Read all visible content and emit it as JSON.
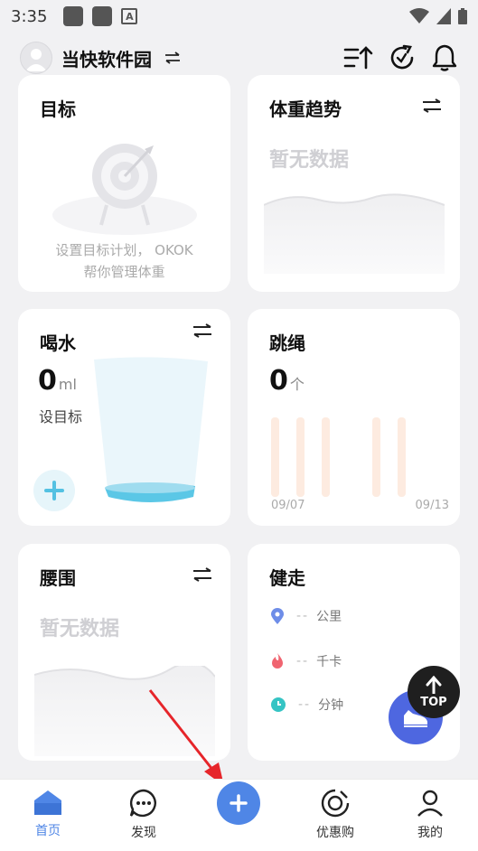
{
  "status": {
    "time": "3:35"
  },
  "header": {
    "user_name": "当快软件园"
  },
  "goal": {
    "title": "目标",
    "desc_line1": "设置目标计划， OKOK",
    "desc_line2": "帮你管理体重"
  },
  "weight": {
    "title": "体重趋势",
    "empty": "暂无数据"
  },
  "water": {
    "title": "喝水",
    "value": "0",
    "unit": "ml",
    "set_goal": "设目标"
  },
  "rope": {
    "title": "跳绳",
    "value": "0",
    "unit": "个",
    "date_start": "09/07",
    "date_end": "09/13"
  },
  "waist": {
    "title": "腰围",
    "empty": "暂无数据"
  },
  "walk": {
    "title": "健走",
    "stats": [
      {
        "value": "--",
        "unit": "公里"
      },
      {
        "value": "--",
        "unit": "千卡"
      },
      {
        "value": "--",
        "unit": "分钟"
      }
    ]
  },
  "fab": {
    "top_label": "TOP"
  },
  "nav": {
    "items": [
      {
        "label": "首页"
      },
      {
        "label": "发现"
      },
      {
        "label": "优惠购"
      },
      {
        "label": "我的"
      }
    ]
  },
  "colors": {
    "accent": "#4f86e6",
    "water": "#5bc7e6",
    "rope_bar": "#fdebe0"
  }
}
